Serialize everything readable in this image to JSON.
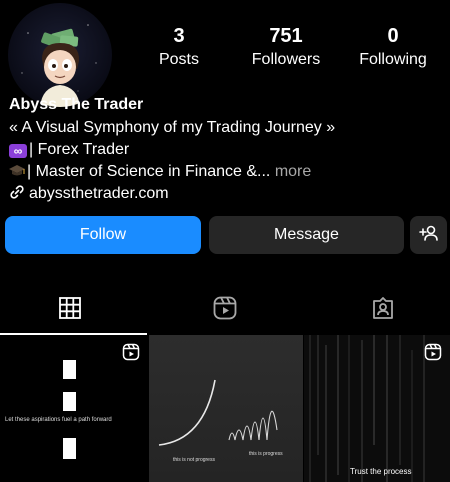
{
  "profile": {
    "posts_count": "3",
    "posts_label": "Posts",
    "followers_count": "751",
    "followers_label": "Followers",
    "following_count": "0",
    "following_label": "Following",
    "name": "Abyss The Trader",
    "bio_line1": "« A Visual Symphony of my Trading Journey »",
    "bio_line2": "| Forex Trader",
    "bio_line3": "| Master of Science in Finance &...",
    "more_label": " more",
    "link": "abyssthetrader.com"
  },
  "actions": {
    "follow_label": "Follow",
    "message_label": "Message"
  },
  "tabs": [
    {
      "icon": "grid-icon",
      "active": true
    },
    {
      "icon": "reels-icon",
      "active": false
    },
    {
      "icon": "tagged-icon",
      "active": false
    }
  ],
  "posts": [
    {
      "caption": "Let these aspirations fuel a path forward",
      "reel": true
    },
    {
      "caption_left": "this is not progress",
      "caption_right": "this is progress",
      "reel": false
    },
    {
      "caption": "Trust the process",
      "reel": true
    }
  ],
  "colors": {
    "background": "#000000",
    "follow_button": "#1a8cff",
    "secondary_button": "#262626",
    "muted_text": "#a8a8a8",
    "emoji_purple": "#8b3fd9"
  }
}
